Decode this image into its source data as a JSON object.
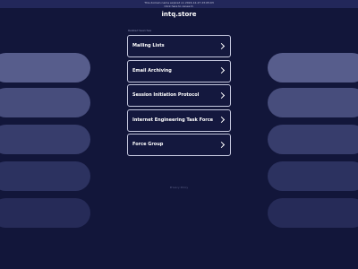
{
  "notice": {
    "line1": "This domain name expired on 2024-12-27 23:05:03",
    "line2": "Click here to renew it."
  },
  "site": {
    "title": "intq.store"
  },
  "related": {
    "label": "Related Searches"
  },
  "links": [
    {
      "label": "Mailing Lists"
    },
    {
      "label": "Email Archiving"
    },
    {
      "label": "Session Initiation Protocol"
    },
    {
      "label": "Internet Engineering Task Force"
    },
    {
      "label": "Force Group"
    }
  ],
  "footer": {
    "privacy_label": "Privacy Policy"
  },
  "colors": {
    "background": "#12163a",
    "notice_bar": "#22275a",
    "pill_1": "#575d8c",
    "pill_2": "#474d7c",
    "pill_3": "#373d6c",
    "pill_4": "#2c3260",
    "pill_5": "#262b58",
    "link_border": "#c4c7de"
  },
  "icons": {
    "link_arrow": "chevron-right-icon"
  }
}
